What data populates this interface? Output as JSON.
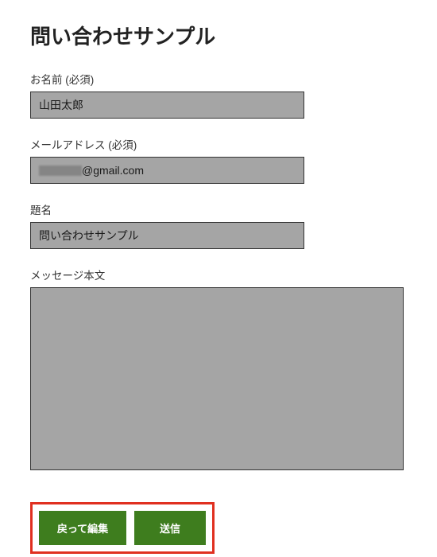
{
  "title": "問い合わせサンプル",
  "fields": {
    "name": {
      "label": "お名前 (必須)",
      "value": "山田太郎"
    },
    "email": {
      "label": "メールアドレス (必須)",
      "value_suffix": "@gmail.com"
    },
    "subject": {
      "label": "題名",
      "value": "問い合わせサンプル"
    },
    "message": {
      "label": "メッセージ本文",
      "value": ""
    }
  },
  "buttons": {
    "back": "戻って編集",
    "submit": "送信"
  }
}
